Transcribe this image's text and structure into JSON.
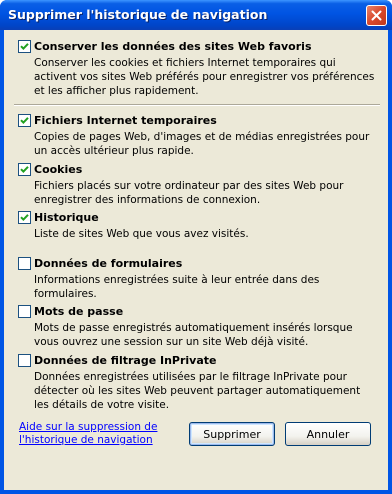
{
  "window": {
    "title": "Supprimer l'historique de navigation"
  },
  "options": [
    {
      "label": "Conserver les données des sites Web favoris",
      "checked": true,
      "description": "Conserver les cookies et fichiers Internet temporaires qui activent vos sites Web préférés pour enregistrer vos préférences et les afficher plus rapidement."
    },
    {
      "label": "Fichiers Internet temporaires",
      "checked": true,
      "description": "Copies de pages Web, d'images et de médias enregistrées pour un accès ultérieur plus rapide."
    },
    {
      "label": "Cookies",
      "checked": true,
      "description": "Fichiers placés sur votre ordinateur par des sites Web pour enregistrer des informations de connexion."
    },
    {
      "label": "Historique",
      "checked": true,
      "description": "Liste de sites Web que vous avez visités."
    },
    {
      "label": "Données de formulaires",
      "checked": false,
      "description": "Informations enregistrées suite à leur entrée dans des formulaires."
    },
    {
      "label": "Mots de passe",
      "checked": false,
      "description": "Mots de passe enregistrés automatiquement insérés lorsque vous ouvrez une session sur un site Web déjà visité."
    },
    {
      "label": "Données de filtrage InPrivate",
      "checked": false,
      "description": "Données enregistrées utilisées par le filtrage InPrivate pour détecter où les sites Web peuvent partager automatiquement les détails de votre visite."
    }
  ],
  "footer": {
    "help_link": "Aide sur la suppression de l'historique de navigation",
    "delete_button": "Supprimer",
    "cancel_button": "Annuler"
  },
  "colors": {
    "titlebar": "#0054e3",
    "client": "#ece9d8",
    "link": "#0000ff"
  }
}
